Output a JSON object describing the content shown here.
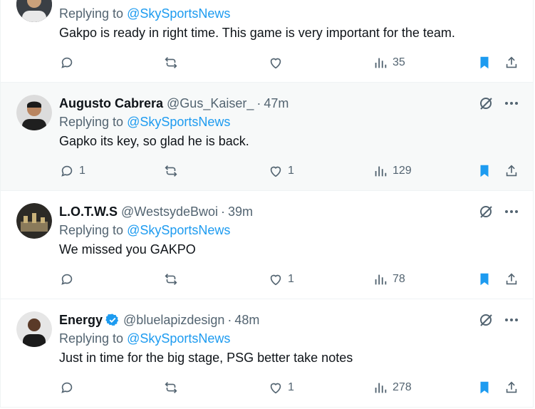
{
  "reply_prefix": "Replying to ",
  "colors": {
    "accent": "#1d9bf0",
    "muted": "#536471",
    "text": "#0f1419"
  },
  "tweets": [
    {
      "user": "",
      "handle": "",
      "time": "",
      "reply_to": "@SkySportsNews",
      "text": "Gakpo is ready in right time. This game is very important for the team.",
      "replies": "",
      "retweets": "",
      "likes": "",
      "views": "35",
      "verified": false
    },
    {
      "user": "Augusto Cabrera",
      "handle": "@Gus_Kaiser_",
      "time": "47m",
      "reply_to": "@SkySportsNews",
      "text": "Gapko its key, so glad he is back.",
      "replies": "1",
      "retweets": "",
      "likes": "1",
      "views": "129",
      "verified": false
    },
    {
      "user": "L.O.T.W.S",
      "handle": "@WestsydeBwoi",
      "time": "39m",
      "reply_to": "@SkySportsNews",
      "text": "We missed you GAKPO",
      "replies": "",
      "retweets": "",
      "likes": "1",
      "views": "78",
      "verified": false
    },
    {
      "user": "Energy",
      "handle": "@bluelapizdesign",
      "time": "48m",
      "reply_to": "@SkySportsNews",
      "text": "Just in time for the big stage, PSG better take notes",
      "replies": "",
      "retweets": "",
      "likes": "1",
      "views": "278",
      "verified": true
    }
  ],
  "icons": {
    "reply": "reply-icon",
    "retweet": "retweet-icon",
    "like": "heart-icon",
    "views": "views-chart-icon",
    "bookmark": "bookmark-icon",
    "share": "share-icon",
    "grok": "grok-icon",
    "more": "more-icon"
  }
}
